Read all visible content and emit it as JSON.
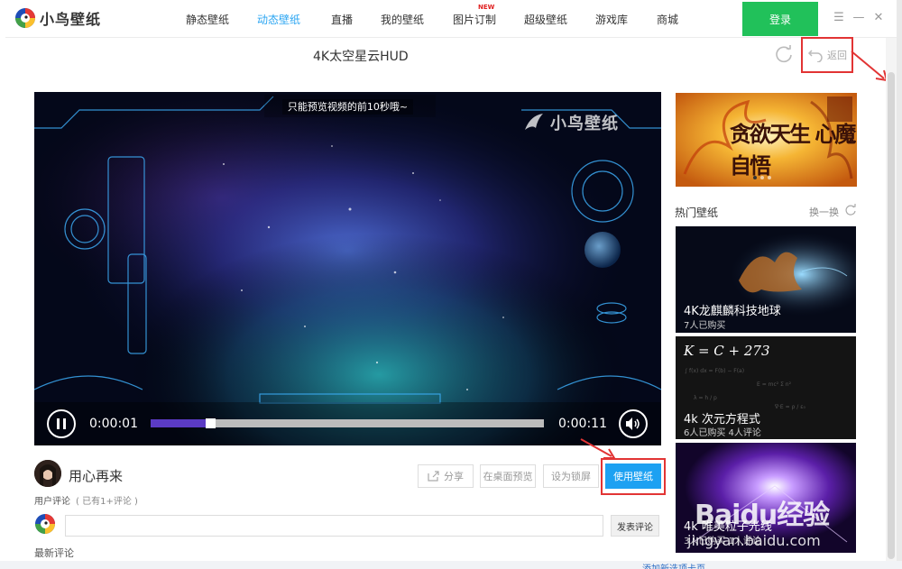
{
  "app": {
    "name": "小鸟壁纸"
  },
  "nav": {
    "items": [
      {
        "label": "静态壁纸"
      },
      {
        "label": "动态壁纸"
      },
      {
        "label": "直播"
      },
      {
        "label": "我的壁纸"
      },
      {
        "label": "图片订制",
        "badge": "NEW"
      },
      {
        "label": "超级壁纸"
      },
      {
        "label": "游戏库"
      },
      {
        "label": "商城"
      }
    ],
    "active": "动态壁纸",
    "login_label": "登录"
  },
  "window_controls": {
    "menu": "☰",
    "minimize": "—",
    "close": "✕"
  },
  "page": {
    "title": "4K太空星云HUD",
    "back_label": "返回"
  },
  "video": {
    "notice": "只能预览视频的前10秒哦~",
    "watermark": "小鸟壁纸",
    "current_time": "0:00:01",
    "total_time": "0:00:11",
    "progress_fraction": 0.14
  },
  "author": {
    "name": "用心再来"
  },
  "actions": {
    "share_label": "分享",
    "preview_label": "在桌面预览",
    "lockscreen_label": "设为锁屏",
    "use_label": "使用壁纸"
  },
  "comments": {
    "label": "用户评论",
    "count_text": "( 已有1+评论 )",
    "input_placeholder": "",
    "post_label": "发表评论",
    "latest_label": "最新评论"
  },
  "sidebar": {
    "banner_text": "贪欲天生 心魔自悟",
    "banner_dots": 3,
    "banner_active_dot": 0,
    "hot_title": "热门壁纸",
    "swap_label": "换一换",
    "cards": [
      {
        "title": "4K龙麒麟科技地球",
        "sub": "7人已购买"
      },
      {
        "title": "4k 次元方程式",
        "sub": "6人已购买    4人评论",
        "formula": "K = C + 273"
      },
      {
        "title": "4k 唯美粒子光线",
        "sub": "3人已购买    1人评论"
      }
    ]
  },
  "watermark": {
    "main": "Baidu经验",
    "sub": "jingyan.baidu.com"
  },
  "bottom_link": "添加新选项卡页"
}
